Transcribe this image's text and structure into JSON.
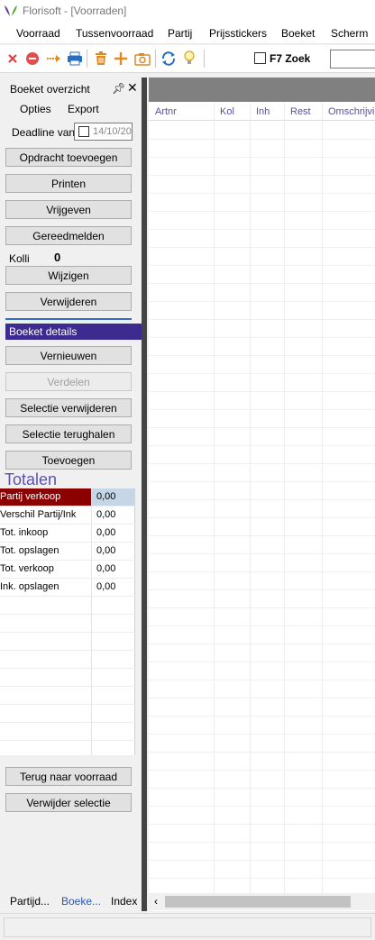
{
  "window": {
    "title": "Florisoft - [Voorraden]"
  },
  "menu": [
    "Voorraad",
    "Tussenvoorraad",
    "Partij",
    "Prijsstickers",
    "Boeket",
    "Scherm"
  ],
  "toolbar": {
    "icons": [
      "close-icon",
      "stop-icon",
      "move-arrow-icon",
      "print-icon",
      "delete-icon",
      "add-icon",
      "camera-icon",
      "refresh-icon",
      "lightbulb-icon"
    ],
    "zoek_label": "F7 Zoek"
  },
  "panel": {
    "title": "Boeket overzicht",
    "tabs": [
      "Opties",
      "Export"
    ],
    "deadline_label": "Deadline van",
    "deadline_value": "14/10/20",
    "buttons_top": [
      "Opdracht toevoegen",
      "Printen",
      "Vrijgeven",
      "Gereedmelden"
    ],
    "kolli_label": "Kolli",
    "kolli_value": "0",
    "buttons_mid": [
      "Wijzigen",
      "Verwijderen"
    ],
    "section_title": "Boeket details",
    "buttons_details": [
      "Vernieuwen",
      "Verdelen",
      "Selectie verwijderen",
      "Selectie terughalen",
      "Toevoegen"
    ],
    "totalen_title": "Totalen",
    "totalen_rows": [
      {
        "label": "Partij verkoop",
        "value": "0,00"
      },
      {
        "label": "Verschil Partij/Ink",
        "value": "0,00"
      },
      {
        "label": "Tot. inkoop",
        "value": "0,00"
      },
      {
        "label": "Tot. opslagen",
        "value": "0,00"
      },
      {
        "label": "Tot. verkoop",
        "value": "0,00"
      },
      {
        "label": "Ink. opslagen",
        "value": "0,00"
      }
    ],
    "buttons_bottom": [
      "Terug naar voorraad",
      "Verwijder selectie"
    ],
    "bottom_tabs": [
      "Partijd...",
      "Boeke...",
      "Index"
    ]
  },
  "grid": {
    "columns": [
      "Artnr",
      "Kol",
      "Inh",
      "Rest",
      "Omschrijvi"
    ]
  },
  "colors": {
    "section_bar": "#3d2b8f",
    "selected_row": "#8b0000",
    "totalen_text": "#5d53a6",
    "column_header_text": "#5b4fa0"
  }
}
